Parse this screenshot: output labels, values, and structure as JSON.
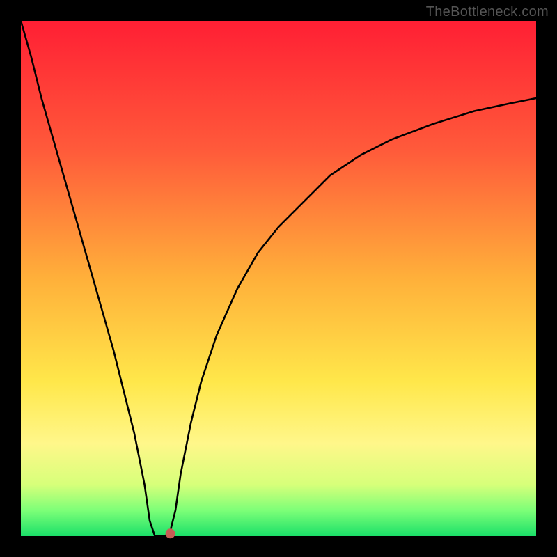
{
  "watermark": "TheBottleneck.com",
  "chart_data": {
    "type": "line",
    "title": "",
    "xlabel": "",
    "ylabel": "",
    "xlim": [
      0,
      100
    ],
    "ylim": [
      0,
      100
    ],
    "x": [
      0,
      2,
      4,
      6,
      8,
      10,
      12,
      14,
      16,
      18,
      20,
      22,
      24,
      25,
      26,
      27,
      28,
      29,
      30,
      31,
      33,
      35,
      38,
      42,
      46,
      50,
      55,
      60,
      66,
      72,
      80,
      88,
      95,
      100
    ],
    "y": [
      100,
      93,
      85,
      78,
      71,
      64,
      57,
      50,
      43,
      36,
      28,
      20,
      10,
      3,
      0,
      0,
      0,
      1,
      5,
      12,
      22,
      30,
      39,
      48,
      55,
      60,
      65,
      70,
      74,
      77,
      80,
      82.5,
      84,
      85
    ],
    "marker": {
      "x": 29,
      "y": 0.5,
      "color": "#c65c55",
      "radius_px": 7
    },
    "background_gradient": {
      "direction": "vertical",
      "stops": [
        {
          "pct": 0,
          "color": "#ff1f34"
        },
        {
          "pct": 25,
          "color": "#ff5a3a"
        },
        {
          "pct": 50,
          "color": "#ffb03a"
        },
        {
          "pct": 70,
          "color": "#ffe74a"
        },
        {
          "pct": 82,
          "color": "#fff78a"
        },
        {
          "pct": 90,
          "color": "#d7ff7a"
        },
        {
          "pct": 95,
          "color": "#7dff78"
        },
        {
          "pct": 100,
          "color": "#1be069"
        }
      ]
    }
  }
}
